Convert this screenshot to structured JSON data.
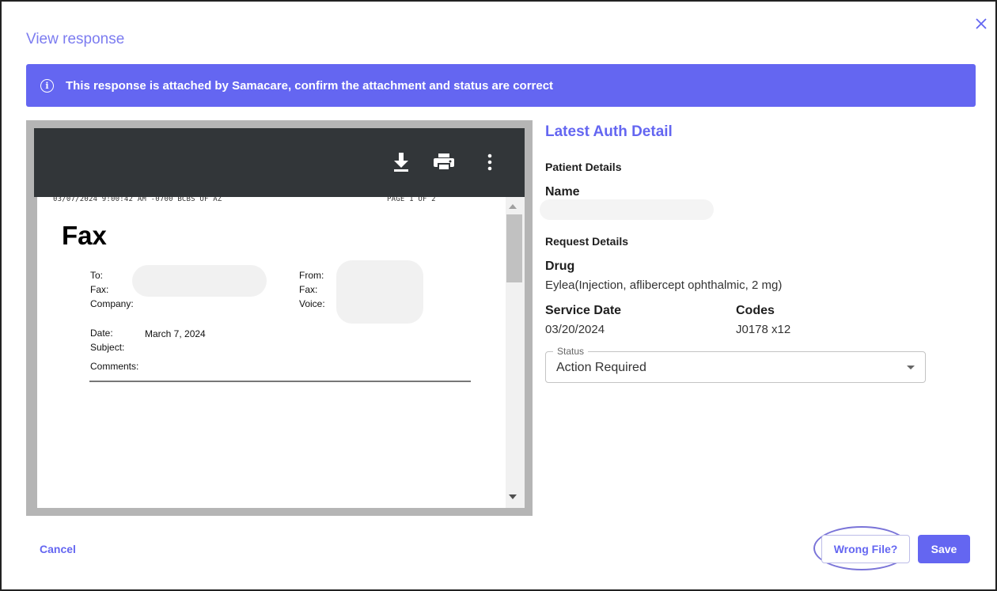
{
  "modal": {
    "title": "View response",
    "close_icon": "close-icon"
  },
  "banner": {
    "icon": "info-icon",
    "text": "This response is attached by Samacare, confirm the attachment and status are correct"
  },
  "viewer": {
    "toolbar_icons": [
      "download-icon",
      "print-icon",
      "more-vert-icon"
    ],
    "document": {
      "header_line": "03/07/2024 9:00:42 AM -0700 BCBS OF AZ",
      "page_indicator": "PAGE 1   OF 2",
      "title": "Fax",
      "to_label": "To:",
      "fax_label": "Fax:",
      "company_label": "Company:",
      "from_label": "From:",
      "from_fax_label": "Fax:",
      "voice_label": "Voice:",
      "date_label": "Date:",
      "date_value": "March 7, 2024",
      "subject_label": "Subject:",
      "comments_label": "Comments:"
    }
  },
  "detail": {
    "title": "Latest Auth Detail",
    "patient_section": "Patient Details",
    "name_label": "Name",
    "request_section": "Request Details",
    "drug_label": "Drug",
    "drug_value": "Eylea(Injection, aflibercept ophthalmic, 2 mg)",
    "service_date_label": "Service Date",
    "service_date_value": "03/20/2024",
    "codes_label": "Codes",
    "codes_value": "J0178 x12",
    "status_label": "Status",
    "status_value": "Action Required"
  },
  "footer": {
    "cancel": "Cancel",
    "wrong_file": "Wrong File?",
    "save": "Save"
  },
  "colors": {
    "accent": "#6466f1",
    "viewer_toolbar": "#323639"
  }
}
